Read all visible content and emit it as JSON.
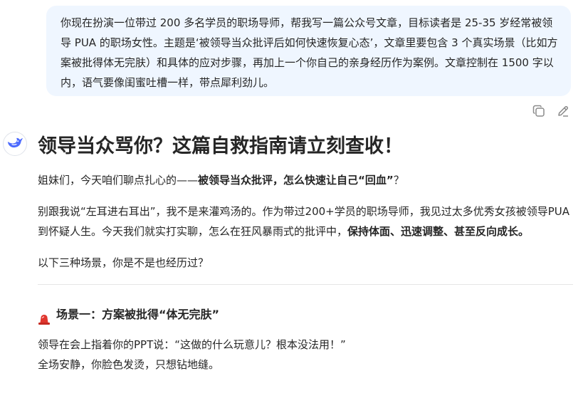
{
  "user_message": {
    "text": "你现在扮演一位带过 200 多名学员的职场导师，帮我写一篇公众号文章，目标读者是 25-35 岁经常被领导 PUA 的职场女性。主题是‘被领导当众批评后如何快速恢复心态’，文章里要包含 3 个真实场景（比如方案被批得体无完肤）和具体的应对步骤，再加上一个你自己的亲身经历作为案例。文章控制在 1500 字以内，语气要像闺蜜吐槽一样，带点犀利劲儿。"
  },
  "user_actions": {
    "copy_icon": "copy-icon",
    "edit_icon": "edit-icon"
  },
  "assistant": {
    "avatar_icon": "whale-icon",
    "title": "领导当众骂你？这篇自救指南请立刻查收！",
    "p1_plain": "姐妹们，今天咱们聊点扎心的——",
    "p1_bold": "被领导当众批评，怎么快速让自己“回血”",
    "p1_end": "？",
    "p2_plain": "别跟我说“左耳进右耳出”，我不是来灌鸡汤的。作为带过200+学员的职场导师，我见过太多优秀女孩被领导PUA到怀疑人生。今天我们就实打实聊，怎么在狂风暴雨式的批评中，",
    "p2_bold": "保持体面、迅速调整、甚至反向成长。",
    "p3": "以下三种场景，你是不是也经历过？",
    "scene1_icon": "siren-icon",
    "scene1_title": "场景一：方案被批得“体无完肤”",
    "scene1_line1": "领导在会上指着你的PPT说：“这做的什么玩意儿？根本没法用！”",
    "scene1_line2": "全场安静，你脸色发烫，只想钻地缝。"
  },
  "colors": {
    "bubble_bg": "#eff6ff",
    "accent": "#4d6bfe",
    "text": "#262626"
  }
}
